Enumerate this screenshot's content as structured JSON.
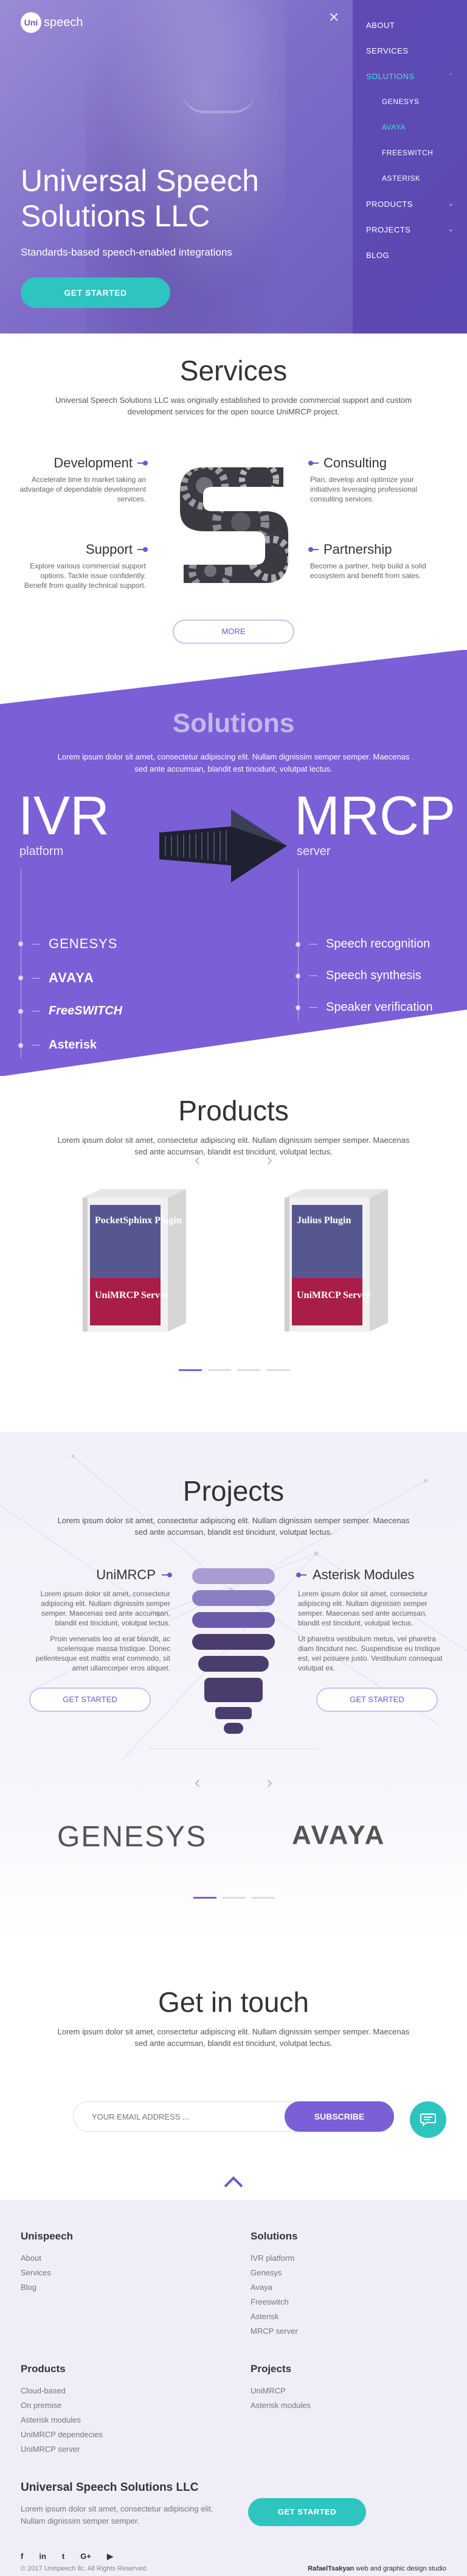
{
  "header": {
    "logo_badge": "Uni",
    "logo_text": "speech",
    "title": "Universal Speech Solutions LLC",
    "subtitle": "Standards-based speech-enabled integrations",
    "cta": "GET STARTED"
  },
  "menu": {
    "items": [
      {
        "label": "ABOUT",
        "active": false,
        "sub": false,
        "chevron": ""
      },
      {
        "label": "SERVICES",
        "active": false,
        "sub": false,
        "chevron": ""
      },
      {
        "label": "SOLUTIONS",
        "active": true,
        "sub": false,
        "chevron": "up"
      },
      {
        "label": "GENESYS",
        "active": false,
        "sub": true,
        "chevron": ""
      },
      {
        "label": "AVAYA",
        "active": true,
        "sub": true,
        "chevron": ""
      },
      {
        "label": "FREESWITCH",
        "active": false,
        "sub": true,
        "chevron": ""
      },
      {
        "label": "ASTERISK",
        "active": false,
        "sub": true,
        "chevron": ""
      },
      {
        "label": "PRODUCTS",
        "active": false,
        "sub": false,
        "chevron": "down"
      },
      {
        "label": "PROJECTS",
        "active": false,
        "sub": false,
        "chevron": "down"
      },
      {
        "label": "BLOG",
        "active": false,
        "sub": false,
        "chevron": ""
      }
    ]
  },
  "services": {
    "title": "Services",
    "description": "Universal Speech Solutions LLC was originally established to provide commercial support and custom development services for the open source UniMRCP project.",
    "development": {
      "title": "Development",
      "text": "Accelerate time to market taking an advantage of dependable development services."
    },
    "consulting": {
      "title": "Consulting",
      "text": "Plan, develop and optimize your initiatives leveraging professional consulting services."
    },
    "support": {
      "title": "Support",
      "text": "Explore various commercial support options. Tackle issue confidently. Benefit from quality technical support."
    },
    "partnership": {
      "title": "Partnership",
      "text": "Become a partner, help build a solid ecosystem and benefit from sales."
    },
    "more": "MORE"
  },
  "solutions": {
    "title": "Solutions",
    "description": "Lorem ipsum dolor sit amet, consectetur adipiscing elit. Nullam dignissim semper semper. Maecenas sed ante accumsan, blandit est tincidunt, volutpat lectus.",
    "ivr": "IVR",
    "ivr_sub": "platform",
    "mrcp": "MRCP",
    "mrcp_sub": "server",
    "platforms": [
      "GENESYS",
      "AVAYA",
      "FreeSWITCH",
      "Asterisk"
    ],
    "features": [
      "Speech recognition",
      "Speech synthesis",
      "Speaker verification"
    ]
  },
  "products": {
    "title": "Products",
    "description": "Lorem ipsum dolor sit amet, consectetur adipiscing elit. Nullam dignissim semper semper. Maecenas sed ante accumsan, blandit est tincidunt, volutpat lectus.",
    "boxes": [
      {
        "name": "PocketSphinx Plugin",
        "brand": "UniMRCP Server"
      },
      {
        "name": "Julius Plugin",
        "brand": "UniMRCP Server"
      }
    ]
  },
  "projects": {
    "title": "Projects",
    "description": "Lorem ipsum dolor sit amet, consectetur adipiscing elit. Nullam dignissim semper semper. Maecenas sed ante accumsan, blandit est tincidunt, volutpat lectus.",
    "unimrcp": {
      "title": "UniMRCP",
      "p1": "Lorem ipsum dolor sit amet, consectetur adipiscing elit. Nullam dignissim semper semper. Maecenas sed ante accumsan, blandit est tincidunt, volutpat lectus.",
      "p2": "Proin venenatis leo at erat blandit, ac scelerisque massa tristique. Donec pellentesque est mattis erat commodo, sit amet ullamcorper eros aliquet.",
      "cta": "GET STARTED"
    },
    "asterisk": {
      "title": "Asterisk Modules",
      "p1": "Lorem ipsum dolor sit amet, consectetur adipiscing elit. Nullam dignissim semper semper. Maecenas sed ante accumsan, blandit est tincidunt, volutpat lectus.",
      "p2": "Ut pharetra vestibulum metus, vel pharetra diam tincidunt nec. Suspendisse eu tristique est, vel posuere justo. Vestibulum consequat volutpat ex.",
      "cta": "GET STARTED"
    },
    "partners": [
      "GENESYS",
      "AVAYA"
    ]
  },
  "contact": {
    "title": "Get in touch",
    "description": "Lorem ipsum dolor sit amet, consectetur adipiscing elit. Nullam dignissim semper semper. Maecenas sed ante accumsan, blandit est tincidunt, volutpat lectus.",
    "email_placeholder": "YOUR EMAIL ADDRESS ...",
    "subscribe": "SUBSCRIBE"
  },
  "footer": {
    "unispeech": {
      "title": "Unispeech",
      "links": [
        "About",
        "Services",
        "Blog"
      ]
    },
    "solutions": {
      "title": "Solutions",
      "links": [
        "IVR platform",
        "Genesys",
        "Avaya",
        "Freeswitch",
        "Asterisk",
        "MRCP server"
      ]
    },
    "products": {
      "title": "Products",
      "links": [
        "Cloud-based",
        "On premise",
        "Asterisk modules",
        "UniMRCP dependecies",
        "UniMRCP server"
      ]
    },
    "projects": {
      "title": "Projects",
      "links": [
        "UniMRCP",
        "Asterisk modules"
      ]
    },
    "company": "Universal Speech Solutions LLC",
    "company_text": "Lorem ipsum dolor sit amet, consectetur adipiscing elit. Nullam dignissim semper semper.",
    "cta": "GET STARTED",
    "social": [
      "f",
      "in",
      "t",
      "G+",
      "yt"
    ],
    "copyright": "© 2017 Unispeech llc. All Rights Reserved.",
    "credit_name": "RafaelTsakyan",
    "credit_rest": "web and graphic design studio"
  },
  "colors": {
    "purple": "#7a5fd6",
    "teal": "#2ec4c0",
    "dark": "#333333"
  }
}
